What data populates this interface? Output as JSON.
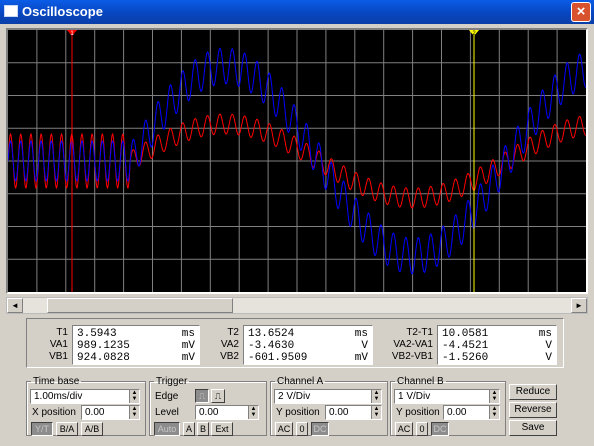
{
  "window": {
    "title": "Oscilloscope",
    "close_glyph": "×"
  },
  "cursors": {
    "t1_marker": "1",
    "t2_marker": "2",
    "t1_color": "#ff0000",
    "t2_color": "#ffff00"
  },
  "readouts": {
    "t1": {
      "labels": [
        "T1",
        "VA1",
        "VB1"
      ],
      "values": [
        "3.5943",
        "989.1235",
        "924.0828"
      ],
      "units": [
        "ms",
        "mV",
        "mV"
      ]
    },
    "t2": {
      "labels": [
        "T2",
        "VA2",
        "VB2"
      ],
      "values": [
        "13.6524",
        "-3.4630",
        "-601.9509"
      ],
      "units": [
        "ms",
        "V",
        "mV"
      ]
    },
    "diff": {
      "labels": [
        "T2-T1",
        "VA2-VA1",
        "VB2-VB1"
      ],
      "values": [
        "10.0581",
        "-4.4521",
        "-1.5260"
      ],
      "units": [
        "ms",
        "V",
        "V"
      ]
    }
  },
  "timebase": {
    "legend": "Time base",
    "scale": "1.00ms/div",
    "x_position_label": "X position",
    "x_position": "0.00",
    "modes": [
      "Y/T",
      "B/A",
      "A/B"
    ]
  },
  "trigger": {
    "legend": "Trigger",
    "edge_label": "Edge",
    "level_label": "Level",
    "level": "0.00",
    "sources": [
      "Auto",
      "A",
      "B",
      "Ext"
    ]
  },
  "channel_a": {
    "legend": "Channel A",
    "scale": "2  V/Div",
    "y_position_label": "Y position",
    "y_position": "0.00",
    "coupling": [
      "AC",
      "0",
      "DC"
    ]
  },
  "channel_b": {
    "legend": "Channel B",
    "scale": "1  V/Div",
    "y_position_label": "Y position",
    "y_position": "0.00",
    "coupling": [
      "AC",
      "0",
      "DC"
    ]
  },
  "actions": {
    "reduce": "Reduce",
    "reverse": "Reverse",
    "save": "Save"
  },
  "scrollbar": {
    "left_arrow": "◄",
    "right_arrow": "►"
  },
  "colors": {
    "channel_a": "#0000ff",
    "channel_b": "#ff0000",
    "screen": "#000000",
    "grid": "#808080"
  }
}
